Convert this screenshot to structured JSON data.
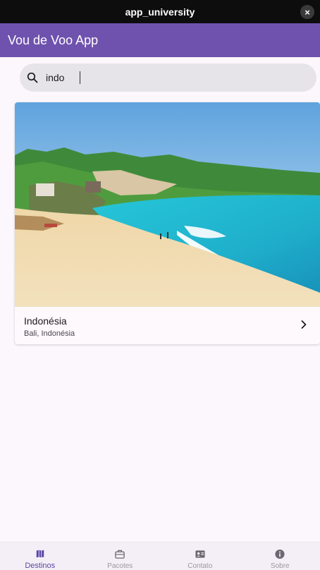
{
  "window": {
    "title": "app_university",
    "close_glyph": "×"
  },
  "app_bar": {
    "title": "Vou de Voo App"
  },
  "search": {
    "value": "indo",
    "icon": "search-icon"
  },
  "results": [
    {
      "title": "Indonésia",
      "subtitle": "Bali, Indonésia",
      "image": "beach-photo",
      "trailing_icon": "chevron-right-icon"
    }
  ],
  "bottom_nav": {
    "items": [
      {
        "label": "Destinos",
        "icon": "map-icon",
        "active": true
      },
      {
        "label": "Pacotes",
        "icon": "luggage-icon",
        "active": false
      },
      {
        "label": "Contato",
        "icon": "contact-card-icon",
        "active": false
      },
      {
        "label": "Sobre",
        "icon": "info-icon",
        "active": false
      }
    ]
  },
  "colors": {
    "app_bar": "#6f52ae",
    "background": "#fcf7fd",
    "search_bg": "#e7e4e9",
    "nav_active": "#5b46a6",
    "nav_inactive": "#9a97a0"
  }
}
